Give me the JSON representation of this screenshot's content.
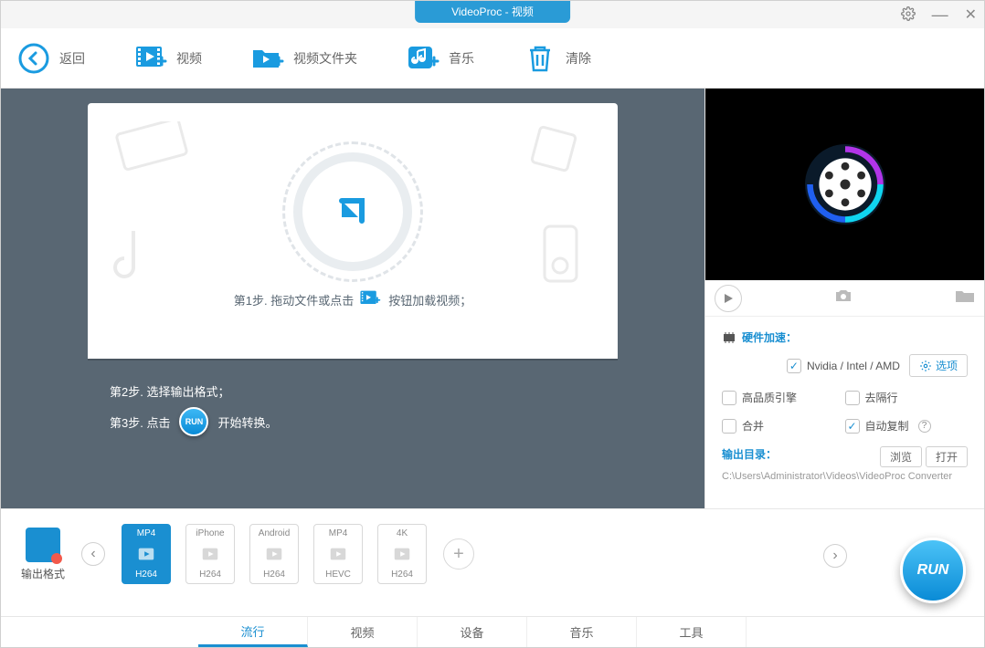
{
  "title": "VideoProc - 视频",
  "toolbar": {
    "back": "返回",
    "video": "视频",
    "folder": "视频文件夹",
    "music": "音乐",
    "clear": "清除"
  },
  "steps": {
    "s1a": "第1步. 拖动文件或点击",
    "s1b": "按钮加载视频；",
    "s2": "第2步. 选择输出格式；",
    "s3a": "第3步. 点击",
    "s3b": "开始转换。",
    "run_mini": "RUN"
  },
  "hw": {
    "title": "硬件加速：",
    "gpu": "Nvidia / Intel / AMD",
    "options": "选项",
    "hq": "高品质引擎",
    "deint": "去隔行",
    "merge": "合并",
    "autocopy": "自动复制"
  },
  "output": {
    "label": "输出目录：",
    "browse": "浏览",
    "open": "打开",
    "path": "C:\\Users\\Administrator\\Videos\\VideoProc Converter"
  },
  "format_label": "输出格式",
  "formats": [
    {
      "top": "MP4",
      "bot": "H264",
      "active": true
    },
    {
      "top": "iPhone",
      "bot": "H264",
      "active": false
    },
    {
      "top": "Android",
      "bot": "H264",
      "active": false
    },
    {
      "top": "MP4",
      "bot": "HEVC",
      "active": false
    },
    {
      "top": "4K",
      "bot": "H264",
      "active": false
    }
  ],
  "tabs": [
    "流行",
    "视频",
    "设备",
    "音乐",
    "工具"
  ],
  "run": "RUN"
}
